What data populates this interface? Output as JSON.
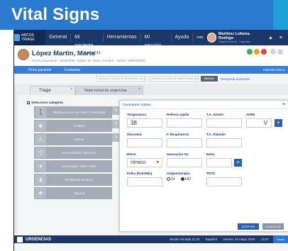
{
  "page_title": "Vital Signs",
  "colors": {
    "header_blue": "#2a7bcf",
    "nav_navy": "#1b3869",
    "accent": "#3a7bd5"
  },
  "nav": {
    "brand": "ARCOS TRIAGE",
    "items": [
      "General",
      "Mi paciente",
      "Herramientas",
      "Mi sección",
      "Ayuda"
    ],
    "small": "más",
    "user_name": "Martínez Lobena, Rodrigo",
    "user_sub": "Hospital General · Urgencias",
    "icons": [
      "gear-icon",
      "bell-icon",
      "menu-icon"
    ]
  },
  "patient": {
    "name": "López Martín, María",
    "bed_label": "Cama",
    "bed": "012",
    "details": "Fecha nacimiento: 12/05/1964 · Edad: 48 · Sexo: Hombre · NUSS: 28/00/01004",
    "toolbar_left": "Ficha paciente",
    "toolbar_mid": "Contactos",
    "toolbar_right": "Historial clínico"
  },
  "search": {
    "placeholder1": "Introduce el número de identificación del paciente",
    "placeholder2": "Introduce el número de historia clínica del paciente",
    "button": "Buscar",
    "link": "Búsqueda avanzada"
  },
  "tabs": [
    "Triage",
    "Nota inicial de urgencias"
  ],
  "category_label": "Seleccione categoría",
  "categories": [
    {
      "icon": "walking-person-icon",
      "label": "Pérdida brusca de visión / motricidad"
    },
    {
      "icon": "head-icon",
      "label": "Cefalea"
    },
    {
      "icon": "body-icon",
      "label": "Disnea"
    },
    {
      "icon": "leg-icon",
      "label": "Extremidades inferiores"
    },
    {
      "icon": "chest-icon",
      "label": "Cervicalgia / dolor cuello"
    },
    {
      "icon": "person-icon",
      "label": "Problemas urinarios"
    },
    {
      "icon": "injury-icon",
      "label": "Trauma"
    }
  ],
  "modal": {
    "title": "Constantes vitales",
    "fields": {
      "temperatura": {
        "label": "Temperatura",
        "value": "38"
      },
      "relleno": {
        "label": "Relleno capilar",
        "value": ""
      },
      "ta_sistole": {
        "label": "T.A. Sístole",
        "value": ""
      },
      "avdn": {
        "label": "AVDN",
        "value": "V"
      },
      "glucemia": {
        "label": "Glucemia",
        "value": ""
      },
      "f_respiratoria": {
        "label": "F. Respiratoria",
        "value": ""
      },
      "ta_diastole": {
        "label": "T.A. Diástole",
        "value": ""
      },
      "ritmo": {
        "label": "Ritmo",
        "value": "rítmico"
      },
      "saturacion": {
        "label": "Saturación O2",
        "value": ""
      },
      "dolor": {
        "label": "Dolor",
        "value": ""
      },
      "pulso": {
        "label": "Pulso (Pulo/Min)",
        "value": ""
      },
      "oxigenoterapia": {
        "label": "Oxigenoterapia",
        "yes": "SÍ",
        "no": "NO",
        "selected": "NO"
      },
      "tetg": {
        "label": "TETG",
        "value": ""
      }
    },
    "accept": "ACEPTAR",
    "cancel": "CANCELAR"
  },
  "bottom": {
    "section": "URGENCIAS",
    "session": "Sesión iniciada 11:23",
    "lang": "Español",
    "date": "Jueves, 24 mayo 2016",
    "time": "13:07",
    "user_btn": "Usuar."
  }
}
